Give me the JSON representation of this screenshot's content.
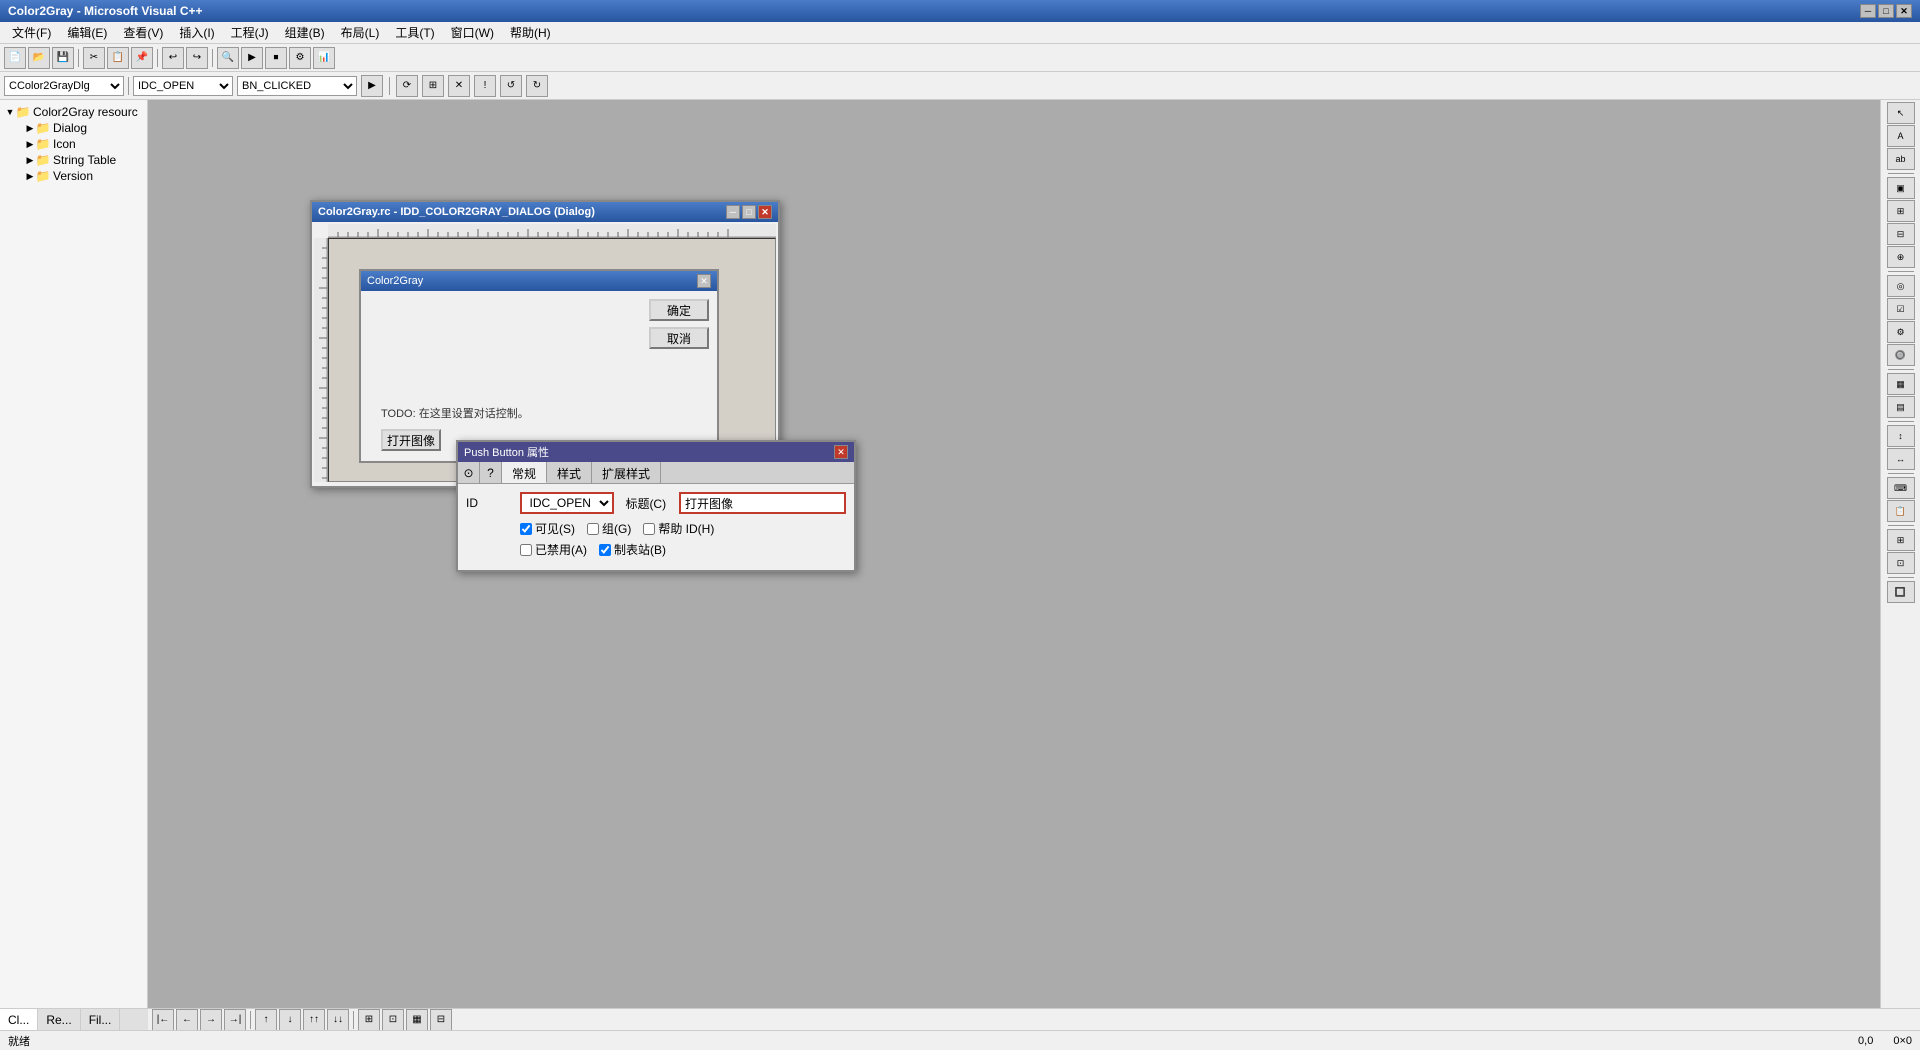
{
  "app": {
    "title": "Color2Gray - Microsoft Visual C++",
    "min_label": "─",
    "max_label": "□",
    "close_label": "✕"
  },
  "menu": {
    "items": [
      {
        "id": "file",
        "label": "文件(F)"
      },
      {
        "id": "edit",
        "label": "编辑(E)"
      },
      {
        "id": "view",
        "label": "查看(V)"
      },
      {
        "id": "insert",
        "label": "插入(I)"
      },
      {
        "id": "project",
        "label": "工程(J)"
      },
      {
        "id": "build",
        "label": "组建(B)"
      },
      {
        "id": "layout",
        "label": "布局(L)"
      },
      {
        "id": "tools",
        "label": "工具(T)"
      },
      {
        "id": "window",
        "label": "窗口(W)"
      },
      {
        "id": "help",
        "label": "帮助(H)"
      }
    ]
  },
  "toolbar2": {
    "class_select": "CColor2GrayDlg",
    "id_select": "IDC_OPEN",
    "event_select": "BN_CLICKED"
  },
  "resource_tree": {
    "root": "Color2Gray resourc",
    "items": [
      {
        "id": "dialog",
        "label": "Dialog",
        "expanded": false
      },
      {
        "id": "icon",
        "label": "Icon",
        "expanded": false
      },
      {
        "id": "string_table",
        "label": "String Table",
        "expanded": false
      },
      {
        "id": "version",
        "label": "Version",
        "expanded": false
      }
    ]
  },
  "resource_editor": {
    "title": "Color2Gray.rc - IDD_COLOR2GRAY_DIALOG (Dialog)",
    "min_label": "─",
    "max_label": "□",
    "close_label": "✕"
  },
  "inner_dialog": {
    "title": "Color2Gray",
    "close_label": "✕",
    "ok_label": "确定",
    "cancel_label": "取消",
    "todo_text": "TODO: 在这里设置对话控制。",
    "open_image_label": "打开图像"
  },
  "props_panel": {
    "title": "Push Button 属性",
    "close_label": "✕",
    "tabs": [
      {
        "id": "general",
        "label": "常规"
      },
      {
        "id": "styles",
        "label": "样式"
      },
      {
        "id": "extended",
        "label": "扩展样式"
      }
    ],
    "id_label": "ID",
    "id_value": "IDC_OPEN",
    "caption_label": "标题(C)",
    "caption_value": "打开图像",
    "checkboxes": [
      {
        "id": "visible",
        "label": "可见(S)",
        "checked": true
      },
      {
        "id": "group",
        "label": "组(G)",
        "checked": false
      },
      {
        "id": "help_id",
        "label": "帮助 ID(H)",
        "checked": false
      }
    ],
    "checkboxes2": [
      {
        "id": "disabled",
        "label": "已禁用(A)",
        "checked": false
      },
      {
        "id": "tabstop",
        "label": "制表站(B)",
        "checked": true
      }
    ]
  },
  "status_bar": {
    "text": "就绪",
    "coords": "0,0",
    "size": "0×0"
  }
}
